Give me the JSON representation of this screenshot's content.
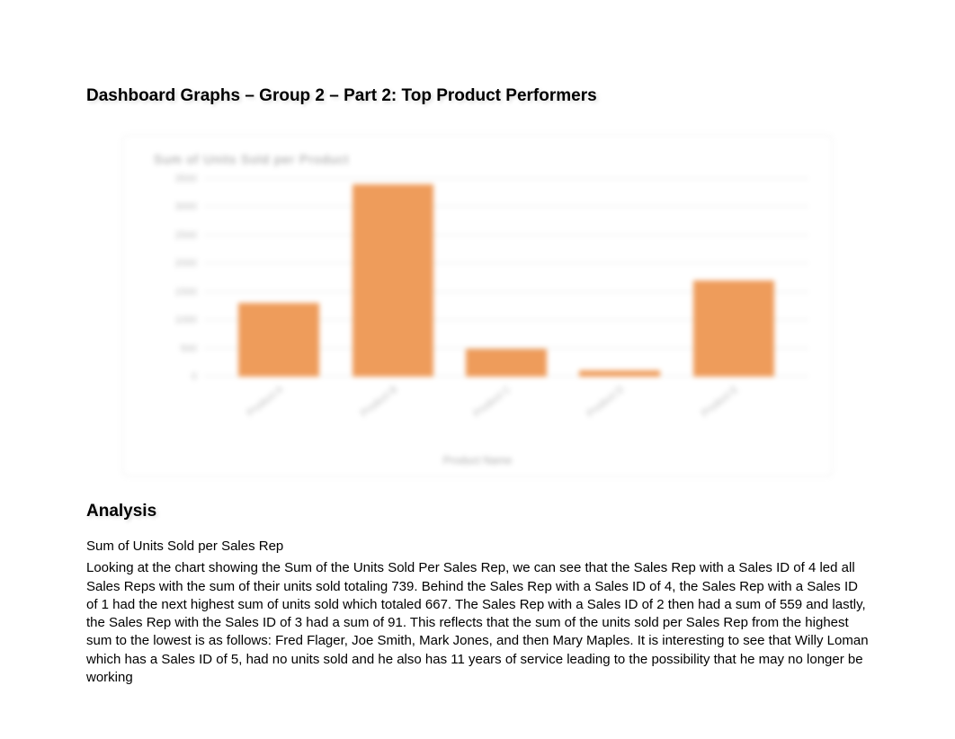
{
  "heading_main": "Dashboard Graphs – Group 2 – Part 2: Top Product Performers",
  "heading_analysis": "Analysis",
  "subheading": "Sum of Units Sold per Sales Rep",
  "body_text": "Looking at the chart showing the Sum of the Units Sold Per Sales Rep, we can see that the Sales Rep with a Sales ID of 4 led all Sales Reps with the sum of their units sold totaling 739.  Behind the Sales Rep with a Sales ID of 4, the Sales Rep with a Sales ID of 1 had the next highest sum of units sold which totaled 667. The Sales Rep with a Sales ID of 2 then had a sum of 559 and lastly, the Sales Rep with the Sales ID of 3 had a sum of 91. This reflects that the sum of the units sold per Sales Rep from the highest sum to the lowest is as follows: Fred Flager, Joe Smith, Mark Jones, and then Mary Maples.  It is interesting to see that Willy Loman which has a Sales ID of 5, had no units sold and he also has 11 years of service leading to the possibility that he may no longer be working",
  "chart_data": {
    "type": "bar",
    "title": "Sum of Units Sold per Product",
    "xlabel": "Product Name",
    "ylabel": "",
    "ylim": [
      0,
      3500
    ],
    "y_ticks": [
      0,
      500,
      1000,
      1500,
      2000,
      2500,
      3000,
      3500
    ],
    "categories": [
      "Product A",
      "Product B",
      "Product C",
      "Product D",
      "Product E"
    ],
    "values": [
      1300,
      3400,
      500,
      120,
      1700
    ],
    "bar_color": "#ee9c5b"
  }
}
